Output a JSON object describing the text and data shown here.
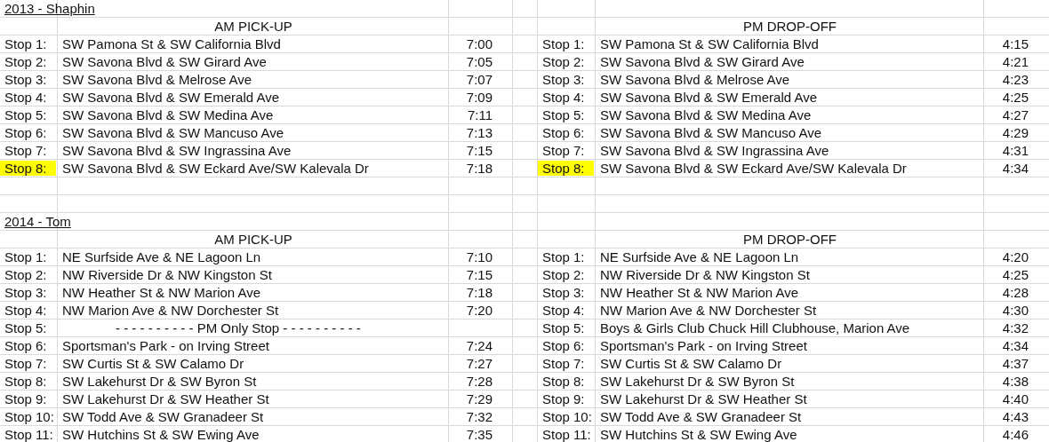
{
  "sections": [
    {
      "title": "2013 - Shaphin",
      "am": {
        "heading": "AM PICK-UP",
        "stops": [
          {
            "label": "Stop 1:",
            "address": "SW Pamona St & SW California Blvd",
            "time": "7:00",
            "highlighted": false
          },
          {
            "label": "Stop 2:",
            "address": "SW Savona Blvd & SW Girard Ave",
            "time": "7:05",
            "highlighted": false
          },
          {
            "label": "Stop 3:",
            "address": "SW Savona Blvd & Melrose Ave",
            "time": "7:07",
            "highlighted": false
          },
          {
            "label": "Stop 4:",
            "address": "SW Savona Blvd & SW Emerald Ave",
            "time": "7:09",
            "highlighted": false
          },
          {
            "label": "Stop 5:",
            "address": "SW Savona Blvd & SW Medina Ave",
            "time": "7:11",
            "highlighted": false
          },
          {
            "label": "Stop 6:",
            "address": "SW Savona Blvd & SW Mancuso Ave",
            "time": "7:13",
            "highlighted": false
          },
          {
            "label": "Stop 7:",
            "address": "SW Savona Blvd & SW Ingrassina Ave",
            "time": "7:15",
            "highlighted": false
          },
          {
            "label": "Stop 8:",
            "address": "SW Savona Blvd & SW Eckard Ave/SW Kalevala Dr",
            "time": "7:18",
            "highlighted": true
          }
        ]
      },
      "pm": {
        "heading": "PM DROP-OFF",
        "stops": [
          {
            "label": "Stop 1:",
            "address": "SW Pamona St & SW California Blvd",
            "time": "4:15",
            "highlighted": false
          },
          {
            "label": "Stop 2:",
            "address": "SW Savona Blvd & SW Girard Ave",
            "time": "4:21",
            "highlighted": false
          },
          {
            "label": "Stop 3:",
            "address": "SW Savona Blvd & Melrose Ave",
            "time": "4:23",
            "highlighted": false
          },
          {
            "label": "Stop 4:",
            "address": "SW Savona Blvd & SW Emerald Ave",
            "time": "4:25",
            "highlighted": false
          },
          {
            "label": "Stop 5:",
            "address": "SW Savona Blvd & SW Medina Ave",
            "time": "4:27",
            "highlighted": false
          },
          {
            "label": "Stop 6:",
            "address": "SW Savona Blvd & SW Mancuso Ave",
            "time": "4:29",
            "highlighted": false
          },
          {
            "label": "Stop 7:",
            "address": "SW Savona Blvd & SW Ingrassina Ave",
            "time": "4:31",
            "highlighted": false
          },
          {
            "label": "Stop 8:",
            "address": "SW Savona Blvd & SW Eckard Ave/SW Kalevala Dr",
            "time": "4:34",
            "highlighted": true
          }
        ]
      }
    },
    {
      "title": "2014 - Tom",
      "am": {
        "heading": "AM PICK-UP",
        "stops": [
          {
            "label": "Stop 1:",
            "address": "NE Surfside Ave & NE Lagoon Ln",
            "time": "7:10",
            "highlighted": false
          },
          {
            "label": "Stop 2:",
            "address": "NW Riverside Dr & NW Kingston St",
            "time": "7:15",
            "highlighted": false
          },
          {
            "label": "Stop 3:",
            "address": "NW Heather St & NW Marion Ave",
            "time": "7:18",
            "highlighted": false
          },
          {
            "label": "Stop 4:",
            "address": "NW Marion Ave & NW Dorchester St",
            "time": "7:20",
            "highlighted": false
          },
          {
            "label": "Stop 5:",
            "address": "- - - - - - - - - - PM Only Stop - - - - - - - - - -",
            "kind": "note",
            "highlighted": false
          },
          {
            "label": "Stop 6:",
            "address": "Sportsman's Park - on Irving Street",
            "time": "7:24",
            "highlighted": false
          },
          {
            "label": "Stop 7:",
            "address": "SW Curtis St & SW Calamo Dr",
            "time": "7:27",
            "highlighted": false
          },
          {
            "label": "Stop 8:",
            "address": "SW Lakehurst Dr & SW Byron St",
            "time": "7:28",
            "highlighted": false
          },
          {
            "label": "Stop 9:",
            "address": "SW Lakehurst Dr & SW Heather St",
            "time": "7:29",
            "highlighted": false
          },
          {
            "label": "Stop 10:",
            "address": "SW Todd Ave & SW Granadeer St",
            "time": "7:32",
            "highlighted": false
          },
          {
            "label": "Stop 11:",
            "address": "SW Hutchins St & SW Ewing Ave",
            "time": "7:35",
            "highlighted": false
          }
        ]
      },
      "pm": {
        "heading": "PM DROP-OFF",
        "stops": [
          {
            "label": "Stop 1:",
            "address": "NE Surfside Ave & NE Lagoon Ln",
            "time": "4:20",
            "highlighted": false
          },
          {
            "label": "Stop 2:",
            "address": "NW Riverside Dr & NW Kingston St",
            "time": "4:25",
            "highlighted": false
          },
          {
            "label": "Stop 3:",
            "address": "NW Heather St & NW Marion Ave",
            "time": "4:28",
            "highlighted": false
          },
          {
            "label": "Stop 4:",
            "address": "NW Marion Ave & NW Dorchester St",
            "time": "4:30",
            "highlighted": false
          },
          {
            "label": "Stop 5:",
            "address": "Boys & Girls Club Chuck Hill Clubhouse, Marion Ave",
            "time": "4:32",
            "highlighted": false
          },
          {
            "label": "Stop 6:",
            "address": "Sportsman's Park - on Irving Street",
            "time": "4:34",
            "highlighted": false
          },
          {
            "label": "Stop 7:",
            "address": "SW Curtis St & SW Calamo Dr",
            "time": "4:37",
            "highlighted": false
          },
          {
            "label": "Stop 8:",
            "address": "SW Lakehurst Dr & SW Byron St",
            "time": "4:38",
            "highlighted": false
          },
          {
            "label": "Stop 9:",
            "address": "SW Lakehurst Dr & SW Heather St",
            "time": "4:40",
            "highlighted": false
          },
          {
            "label": "Stop 10:",
            "address": "SW Todd Ave & SW Granadeer St",
            "time": "4:43",
            "highlighted": false
          },
          {
            "label": "Stop 11:",
            "address": "SW Hutchins St & SW Ewing Ave",
            "time": "4:46",
            "highlighted": false
          }
        ]
      }
    }
  ]
}
